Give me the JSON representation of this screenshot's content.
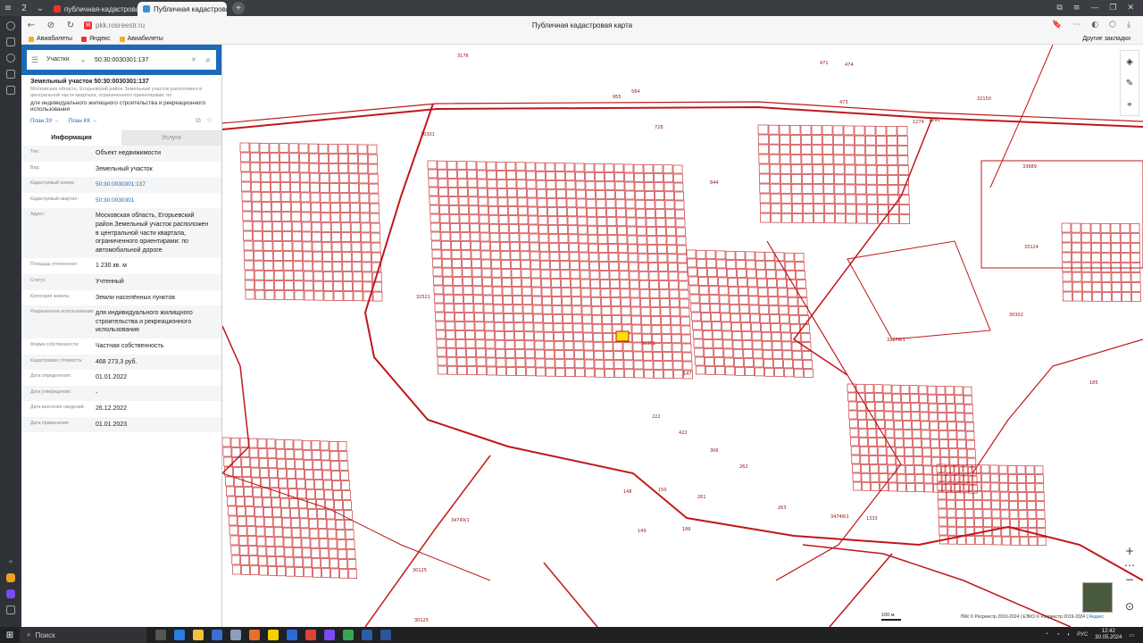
{
  "browser": {
    "tabs": [
      {
        "label": "публичная-кадастровая",
        "fav_color": "#e33"
      },
      {
        "label": "Публичная кадастровая",
        "fav_color": "#3a8fd6"
      }
    ],
    "tab_counter": "2",
    "url": "pkk.rosreestr.ru",
    "page_title": "Публичная кадастровая карта",
    "bookmarks": [
      "Авиабилеты",
      "Яндекс",
      "Авиабилеты"
    ],
    "other_bookmarks": "Другие закладки"
  },
  "panel": {
    "search": {
      "category": "Участки",
      "query": "50:30:0030301:137"
    },
    "object_title": "Земельный участок 50:30:0030301:137",
    "object_desc": "Московская область, Егорьевский район Земельный участок расположен в центральной части квартала, ограниченного ориентирами: по автомобильной...",
    "object_use": "для индивидуального жилищного строительства и рекреационного использования",
    "plan_zu": "План ЗУ →",
    "plan_kk": "План КК →",
    "tabs": {
      "info": "Информация",
      "services": "Услуги"
    },
    "rows": [
      {
        "label": "Тип:",
        "value": "Объект недвижимости"
      },
      {
        "label": "Вид:",
        "value": "Земельный участок"
      },
      {
        "label": "Кадастровый номер:",
        "value": "50:30:0030301:137"
      },
      {
        "label": "Кадастровый квартал:",
        "value": "50:30:0030301"
      },
      {
        "label": "Адрес:",
        "value": "Московская область, Егорьевский район.Земельный участок расположен в центральной части квартала, ограниченного ориентирами: по автомобильной дороге"
      },
      {
        "label": "Площадь уточненная:",
        "value": "1 230 кв. м"
      },
      {
        "label": "Статус:",
        "value": "Учтенный"
      },
      {
        "label": "Категория земель:",
        "value": "Земли населённых пунктов"
      },
      {
        "label": "Разрешенное использование:",
        "value": "для индивидуального жилищного строительства и рекреационного использования"
      },
      {
        "label": "Форма собственности:",
        "value": "Частная собственность"
      },
      {
        "label": "Кадастровая стоимость:",
        "value": "468 273,3 руб."
      },
      {
        "label": "Дата определения:",
        "value": "01.01.2022"
      },
      {
        "label": "Дата утверждения:",
        "value": "-"
      },
      {
        "label": "Дата внесения сведений:",
        "value": "26.12.2022"
      },
      {
        "label": "Дата применения:",
        "value": "01.01.2023"
      }
    ]
  },
  "map": {
    "parcel_color": "#c0171a",
    "highlight_color": "#ffe000",
    "labels": [
      "1151",
      "3176",
      "471",
      "474",
      "955",
      "32150",
      "473",
      "728",
      "1291",
      "1274",
      "584",
      "30301",
      "32521",
      "844",
      "33124",
      "32276/1",
      "30302",
      "185",
      "147",
      "222",
      "422",
      "306",
      "262",
      "263",
      "186",
      "149",
      "150",
      "261",
      "148",
      "34749/1",
      "30125",
      "1333",
      "30125",
      "34748/1",
      "33689",
      "30301"
    ],
    "scale": "100 м",
    "copyright": "ПКК © Росреестр 2010-2024 | ЕЭКО © Росреестр 2019-2024 | ",
    "copyright_yandex": "Яндекс"
  },
  "taskbar": {
    "search_placeholder": "Поиск",
    "lang": "РУС",
    "time": "12:42",
    "date": "30.05.2024"
  }
}
